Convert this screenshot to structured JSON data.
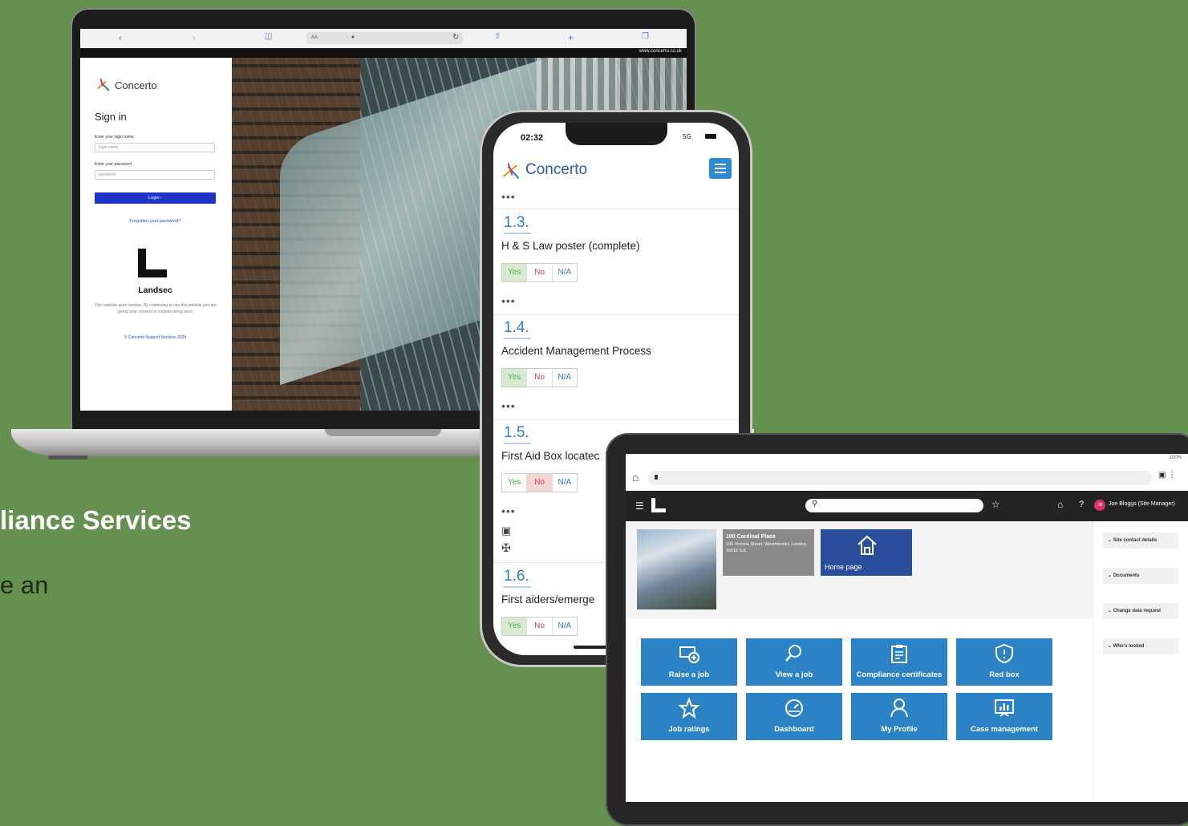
{
  "background": {
    "heading": "liance Services",
    "body": "e an",
    "color": "#65904f"
  },
  "laptop": {
    "url_strip": "www.concerto.co.uk",
    "safari": {
      "back": "‹",
      "forward": "›",
      "address": "AA"
    },
    "brand": "Concerto",
    "signin_title": "Sign in",
    "login_label": "Enter your login name",
    "login_placeholder": "login name",
    "password_label": "Enter your password",
    "password_placeholder": "password",
    "login_button": "Login ›",
    "forgot": "Forgotten your password?",
    "client_logo_text": "Landsec",
    "cookie_notice": "This website uses cookies. By continuing to use this website you are giving your consent to cookies being used.",
    "copyright": "© Concerto Support Services 2024",
    "accent": "#1e35c8"
  },
  "phone": {
    "time": "02:32",
    "signal": "5G",
    "brand": "Concerto",
    "sections": [
      {
        "num": "1.3.",
        "title": "H & S Law poster (complete)",
        "yes": "Yes",
        "no": "No",
        "na": "N/A",
        "selected": "yes"
      },
      {
        "num": "1.4.",
        "title": "Accident Management Process",
        "yes": "Yes",
        "no": "No",
        "na": "N/A",
        "selected": "yes"
      },
      {
        "num": "1.5.",
        "title": "First Aid Box locatec",
        "yes": "Yes",
        "no": "No",
        "na": "N/A",
        "selected": "no"
      },
      {
        "num": "1.6.",
        "title": "First aiders/emerge",
        "yes": "Yes",
        "no": "No",
        "na": "N/A",
        "selected": "yes"
      }
    ],
    "dots": "•••",
    "accent": "#2e7bbf"
  },
  "tablet": {
    "status": "100%",
    "user": "Joe Bloggs (Site Manager)",
    "avatar_initials": "JB",
    "client_logo_text": "Landsec",
    "site": {
      "name": "100 Cardinal Place",
      "address": "100 Victoria Street, Westminster, London, SW1E 5JL"
    },
    "home_card": "Home page",
    "sidebar": [
      "Site contact details",
      "Documents",
      "Change data request",
      "Who's looked"
    ],
    "tiles": [
      {
        "label": "Raise a job",
        "icon": "raise-job-icon"
      },
      {
        "label": "View a job",
        "icon": "view-job-icon"
      },
      {
        "label": "Compliance certificates",
        "icon": "compliance-certificates-icon"
      },
      {
        "label": "Red box",
        "icon": "red-box-icon"
      },
      {
        "label": "Job ratings",
        "icon": "job-ratings-icon"
      },
      {
        "label": "Dashboard",
        "icon": "dashboard-icon"
      },
      {
        "label": "My Profile",
        "icon": "my-profile-icon"
      },
      {
        "label": "Case management",
        "icon": "case-management-icon"
      }
    ],
    "tile_color": "#2b83c5",
    "nav_color": "#232323"
  }
}
